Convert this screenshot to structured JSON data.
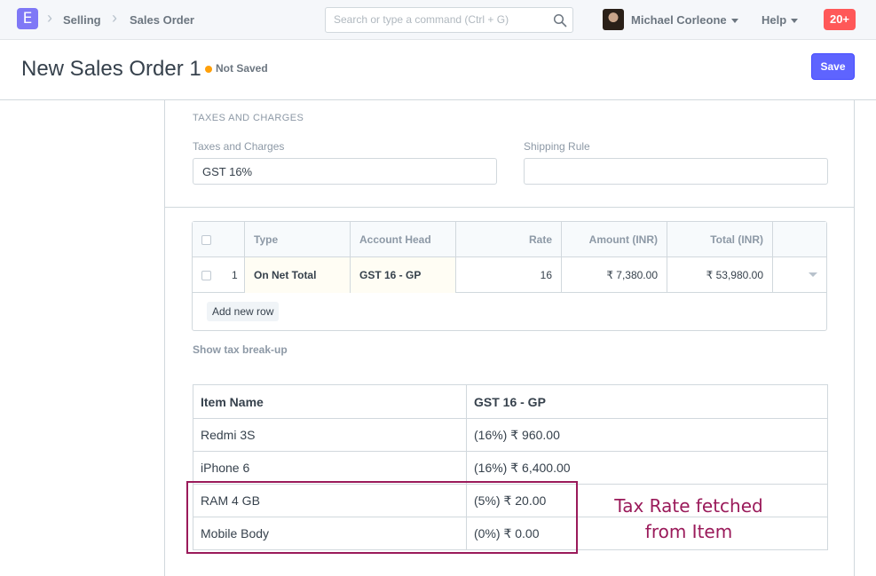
{
  "navbar": {
    "logo": "E",
    "breadcrumbs": [
      "Selling",
      "Sales Order"
    ],
    "search_placeholder": "Search or type a command (Ctrl + G)",
    "user": "Michael Corleone",
    "help": "Help",
    "notifications": "20+"
  },
  "page": {
    "title": "New Sales Order 1",
    "status": "Not Saved",
    "save_label": "Save"
  },
  "section": {
    "heading": "TAXES AND CHARGES",
    "taxes_label": "Taxes and Charges",
    "taxes_value": "GST 16%",
    "shipping_label": "Shipping Rule",
    "shipping_value": ""
  },
  "grid": {
    "columns": [
      "Type",
      "Account Head",
      "Rate",
      "Amount (INR)",
      "Total (INR)"
    ],
    "rows": [
      {
        "idx": "1",
        "type": "On Net Total",
        "account_head": "GST 16 - GP",
        "rate": "16",
        "amount": "₹ 7,380.00",
        "total": "₹ 53,980.00"
      }
    ],
    "add_row": "Add new row"
  },
  "breakup_link": "Show tax break-up",
  "breakup": {
    "headers": [
      "Item Name",
      "GST 16 - GP"
    ],
    "rows": [
      [
        "Redmi 3S",
        "(16%) ₹ 960.00"
      ],
      [
        "iPhone 6",
        "(16%) ₹ 6,400.00"
      ],
      [
        "RAM 4 GB",
        "(5%) ₹ 20.00"
      ],
      [
        "Mobile Body",
        "(0%) ₹ 0.00"
      ]
    ]
  },
  "annotation": {
    "line1": "Tax Rate fetched",
    "line2": "from Item",
    "color": "#9a1a5a"
  },
  "colors": {
    "brand": "#7f78f6",
    "primary": "#5e64ff",
    "notification": "#ff5858",
    "status_dot": "#ffa00a"
  }
}
